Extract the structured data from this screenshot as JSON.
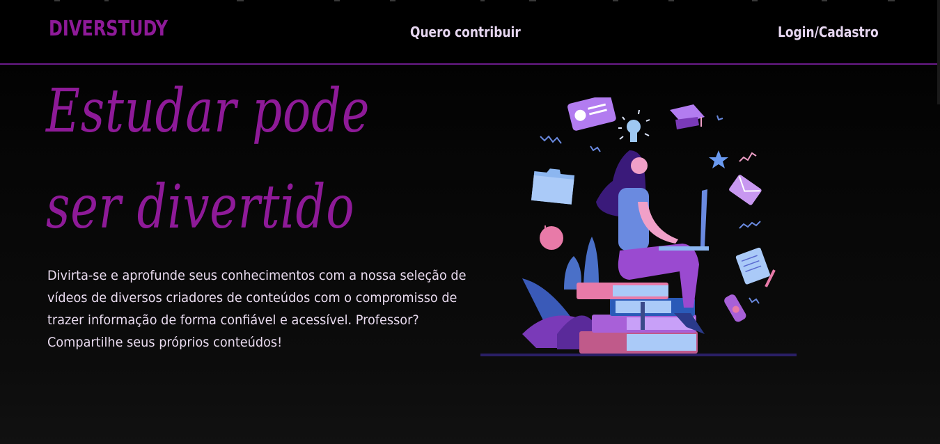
{
  "header": {
    "logo": "DIVERSTUDY",
    "nav": [
      {
        "label": "Quero contribuir"
      },
      {
        "label": "Login/Cadastro"
      }
    ]
  },
  "hero": {
    "headline_line1": "Estudar pode",
    "headline_line2": "ser divertido",
    "description_lines": [
      "Divirta-se e aprofunde seus conhecimentos com a nossa seleção de",
      "vídeos de diversos criadores de conteúdos com o compromisso de",
      "trazer informação de forma confiável e acessível. Professor?",
      "Compartilhe seus próprios conteúdos!"
    ]
  },
  "colors": {
    "brand": "#8e1a98",
    "header_border": "#6a1b8a",
    "text_light": "#eadcf0",
    "background": "#0a0a0a"
  },
  "illustration": {
    "icons": [
      "id-card-icon",
      "lightbulb-icon",
      "graduation-cap-icon",
      "folder-icon",
      "star-icon",
      "envelope-icon",
      "apple-icon",
      "notebook-icon",
      "pencil-icon",
      "diploma-icon",
      "laptop-icon",
      "books-icon",
      "plant-icon"
    ]
  }
}
